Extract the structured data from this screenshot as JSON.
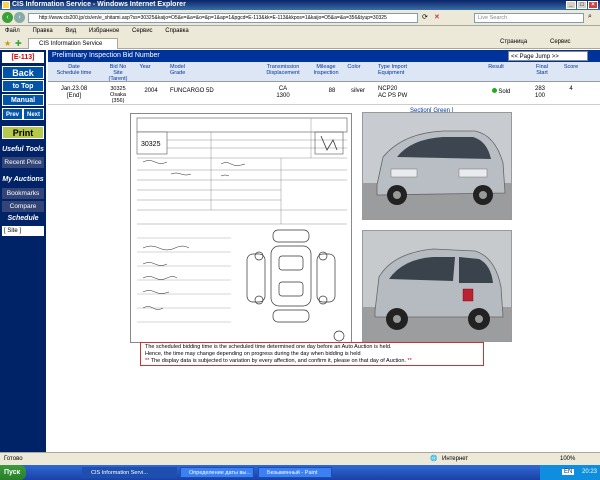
{
  "window": {
    "title": "CIS Information Service - Windows Internet Explorer"
  },
  "address": {
    "url": "http://www.cis200.jp/cis/en/e_shitami.asp?ss=30325&kaijo=O5&e=&a=&o=&p=1&ap=1&pgcd=E-113&kk=E-113&kkpos=1&kaijo=O5&a=&a=356&tyup=30325",
    "search_placeholder": "Live Search"
  },
  "menu": [
    "Файл",
    "Правка",
    "Вид",
    "Избранное",
    "Сервис",
    "Справка"
  ],
  "tab": {
    "label": "CIS Information Service"
  },
  "toolbar": {
    "page_label": "Страница",
    "tools_label": "Сервис"
  },
  "sidebar": {
    "code": "[E-113]",
    "back": "Back",
    "to_top": "to Top",
    "manual": "Manual",
    "prev": "Prev",
    "next": "Next",
    "print": "Print",
    "useful_tools": "Useful Tools",
    "recent_price": "Recent Price",
    "my_auctions": "My Auctions",
    "bookmarks": "Bookmarks",
    "compare": "Compare",
    "schedule": "Schedule",
    "site_select": "[ Site ]"
  },
  "header": {
    "title": "Preliminary Inspection Bid Number",
    "page_jump": "<< Page Jump >>"
  },
  "columns": {
    "date": "Date\nSchedule time",
    "bidno": "Bid No\nSite\n(Tarent)",
    "year": "Year",
    "model": "Model\nGrade",
    "trans": "Transmission\nDisplacement",
    "mileage": "Mileage\nInspection",
    "color": "Color",
    "type": "Type Import\nEquipment",
    "result": "Result",
    "final": "Final\nStart",
    "score": "Score"
  },
  "row": {
    "date": "Jan.23.08\n[End]",
    "bidno": "30325\nOsaka\n(356)",
    "year": "2004",
    "model": "FUNCARGO 5D",
    "trans": "CA\n1300",
    "mileage": "88",
    "color": "silver",
    "type": "NCP20\nAC PS PW",
    "result": "Sold",
    "final": "283\n100",
    "score": "4"
  },
  "section_label": "Section[ Green ]",
  "sheet": {
    "lot": "30325"
  },
  "notice": {
    "line1": "The scheduled bidding time is the scheduled time determined one day before an Auto Auction is held.",
    "line2": "Hence, the time may change depending on progress during the day when bidding is held",
    "star": "**",
    "line3": "The display data is subjected to variation by every affection, and confirm it, please on that day of Auction."
  },
  "status": {
    "left": "Готово",
    "zone": "Интернет",
    "zoom": "100%"
  },
  "taskbar": {
    "start": "Пуск",
    "tasks": [
      "CIS Information Servi...",
      "Определение даты вы...",
      "Безымянный - Paint"
    ],
    "lang": "EN",
    "clock": "20:23"
  },
  "colors": {
    "accent": "#003399",
    "sidebar": "#002266",
    "sold": "#22aa22"
  }
}
